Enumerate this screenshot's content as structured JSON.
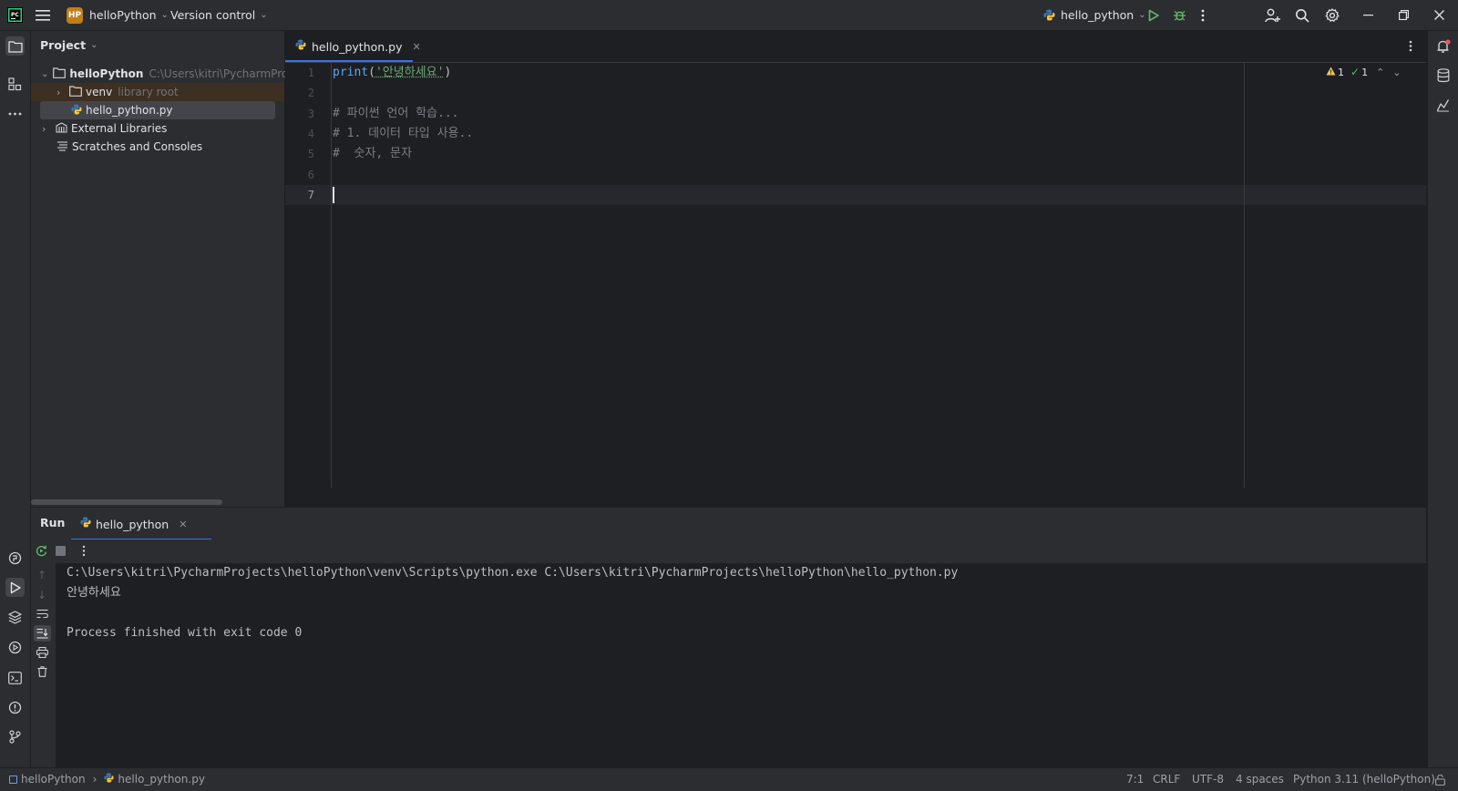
{
  "titlebar": {
    "app_icon": "pycharm-icon",
    "project_badge": "HP",
    "project_name": "helloPython",
    "vcs_label": "Version control",
    "run_config": "hello_python"
  },
  "project_panel": {
    "title": "Project",
    "root_name": "helloPython",
    "root_path": "C:\\Users\\kitri\\PycharmProjects",
    "venv_name": "venv",
    "venv_hint": "library root",
    "file_name": "hello_python.py",
    "external_libs": "External Libraries",
    "scratches": "Scratches and Consoles"
  },
  "editor": {
    "tab_label": "hello_python.py",
    "line_numbers": [
      "1",
      "2",
      "3",
      "4",
      "5",
      "6",
      "7"
    ],
    "line1_fn": "print",
    "line1_open": "(",
    "line1_str": "'안녕하세요'",
    "line1_close": ")",
    "line3": "# 파이썬 언어 학습...",
    "line4": "# 1. 데이터 타입 사용..",
    "line5": "#  숫자, 문자",
    "warnings_count": "1",
    "checks_count": "1"
  },
  "run_panel": {
    "run_tab": "Run",
    "config_tab": "hello_python",
    "lines": [
      "C:\\Users\\kitri\\PycharmProjects\\helloPython\\venv\\Scripts\\python.exe C:\\Users\\kitri\\PycharmProjects\\helloPython\\hello_python.py",
      "안녕하세요",
      "",
      "Process finished with exit code 0"
    ]
  },
  "statusbar": {
    "crumb_project": "helloPython",
    "crumb_file": "hello_python.py",
    "position": "7:1",
    "line_sep": "CRLF",
    "encoding": "UTF-8",
    "indent": "4 spaces",
    "interpreter": "Python 3.11 (helloPython)"
  },
  "colors": {
    "accent": "#3574f0",
    "run_green": "#5fb865",
    "warning": "#f2c55c",
    "notification_dot": "#e55765"
  }
}
